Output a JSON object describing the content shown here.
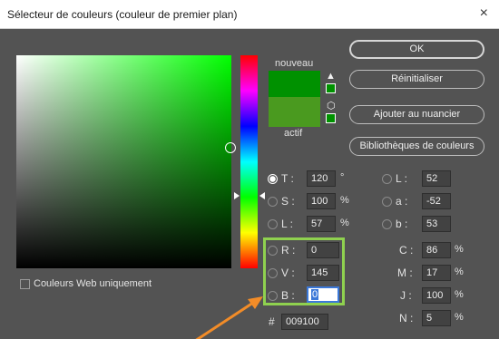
{
  "dialog": {
    "title": "Sélecteur de couleurs (couleur de premier plan)",
    "close_glyph": "×"
  },
  "swatches": {
    "new_label": "nouveau",
    "current_label": "actif",
    "new_color": "#009100",
    "current_color": "#4a9a1f",
    "warning_icon": "gamut-warning-icon",
    "cube_icon": "web-safe-cube-icon"
  },
  "buttons": {
    "ok": "OK",
    "reset": "Réinitialiser",
    "add_swatch": "Ajouter au nuancier",
    "libraries": "Bibliothèques de couleurs"
  },
  "hsb": {
    "h": {
      "label": "T :",
      "value": "120",
      "unit": "°",
      "selected": true
    },
    "s": {
      "label": "S :",
      "value": "100",
      "unit": "%"
    },
    "b": {
      "label": "L :",
      "value": "57",
      "unit": "%"
    }
  },
  "lab": {
    "l": {
      "label": "L :",
      "value": "52"
    },
    "a": {
      "label": "a :",
      "value": "-52"
    },
    "b": {
      "label": "b :",
      "value": "53"
    }
  },
  "rgb": {
    "r": {
      "label": "R :",
      "value": "0"
    },
    "g": {
      "label": "V :",
      "value": "145"
    },
    "b": {
      "label": "B :",
      "value": "0"
    }
  },
  "cmyk": {
    "c": {
      "label": "C :",
      "value": "86",
      "unit": "%"
    },
    "m": {
      "label": "M :",
      "value": "17",
      "unit": "%"
    },
    "y": {
      "label": "J :",
      "value": "100",
      "unit": "%"
    },
    "k": {
      "label": "N :",
      "value": "5",
      "unit": "%"
    }
  },
  "hex": {
    "label": "#",
    "value": "009100"
  },
  "web_only": {
    "label": "Couleurs Web uniquement",
    "checked": false
  },
  "annotation": {
    "highlight_color": "#8fd14f",
    "arrow_color": "#f28c28"
  }
}
